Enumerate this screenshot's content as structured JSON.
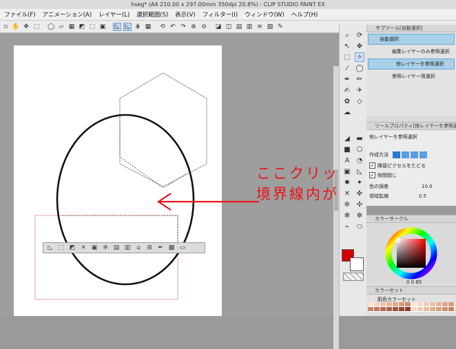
{
  "window": {
    "title": "hseg* (A4 210.00 x 297.00mm 350dpi 20.8%) - CLIP STUDIO PAINT EX"
  },
  "menu": {
    "items": [
      "ファイル(F)",
      "アニメーション(A)",
      "レイヤー(L)",
      "選択範囲(S)",
      "表示(V)",
      "フィルター(I)",
      "ウィンドウ(W)",
      "ヘルプ(H)"
    ]
  },
  "annotation": {
    "line1": "ここクリックすると",
    "line2": "境界線内が範囲選択"
  },
  "subtool_panel": {
    "header": "サブツール[自動選択]",
    "group": "自動選択",
    "items": [
      {
        "label": "編集レイヤーのみ参照選択",
        "active": false
      },
      {
        "label": "他レイヤーを参照選択",
        "active": true
      },
      {
        "label": "参照レイヤー用選択",
        "active": false
      }
    ]
  },
  "tool_property": {
    "header": "ツールプロパティ[他レイヤーを参照選択]",
    "subtool_name": "他レイヤーを参照選択",
    "method_label": "作成方法",
    "follow_adjacent_label": "隣接ピクセルをたどる",
    "close_gap_label": "隙間閉じ",
    "color_margin_label": "色の誤差",
    "color_margin_value": "10.0",
    "expand_label": "領域拡縮",
    "expand_value": "0.5"
  },
  "color_wheel": {
    "header": "カラーサークル",
    "readout": "0 0 85",
    "ring_colors": [
      "#ff0000",
      "#ffff00",
      "#00ff00",
      "#00ffff",
      "#0000ff",
      "#ff00ff",
      "#ff0000"
    ]
  },
  "color_set": {
    "header": "カラーセット",
    "set_name": "肌色カラーセット"
  },
  "colors": {
    "main_color": "#d40000",
    "sub_color": "#ffffff",
    "accent": "#e8131a",
    "selection_fill": "#a8d0e8"
  }
}
